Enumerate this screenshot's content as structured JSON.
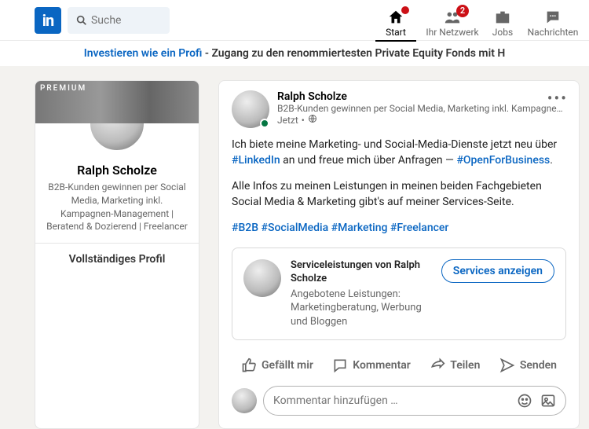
{
  "header": {
    "logo_text": "in",
    "search_placeholder": "Suche",
    "nav": [
      {
        "label": "Start",
        "badge": ""
      },
      {
        "label": "Ihr Netzwerk",
        "badge": "2"
      },
      {
        "label": "Jobs",
        "badge": ""
      },
      {
        "label": "Nachrichten",
        "badge": ""
      }
    ]
  },
  "promo": {
    "link_text": "Investieren wie ein Profi",
    "rest_text": " - Zugang zu den renommiertesten Private Equity Fonds mit H"
  },
  "profile_card": {
    "premium_label": "PREMIUM",
    "name": "Ralph Scholze",
    "desc": "B2B-Kunden gewinnen per Social Media, Marketing inkl. Kampagnen-Management | Beratend & Dozierend | Freelancer",
    "full_profile": "Vollständiges Profil"
  },
  "post": {
    "author_name": "Ralph Scholze",
    "author_sub": "B2B-Kunden gewinnen per Social Media, Marketing inkl. Kampagnen-M…",
    "time": "Jetzt",
    "body": {
      "p1_a": "Ich biete meine Marketing- und Social-Media-Dienste jetzt neu über ",
      "ht1": "#LinkedIn",
      "p1_b": " an und freue mich über Anfragen — ",
      "ht2": "#OpenForBusiness",
      "p1_c": ".",
      "p2": "Alle Infos zu meinen Leistungen in meinen beiden Fachgebieten Social Media & Marketing gibt's auf meiner Services-Seite.",
      "tags": "#B2B #SocialMedia #Marketing #Freelancer"
    },
    "service": {
      "title": "Serviceleistungen von Ralph Scholze",
      "sub": "Angebotene Leistungen: Marketingberatung, Werbung und Bloggen",
      "button": "Services anzeigen"
    },
    "actions": {
      "like": "Gefällt mir",
      "comment": "Kommentar",
      "share": "Teilen",
      "send": "Senden"
    },
    "comment_placeholder": "Kommentar hinzufügen …"
  }
}
